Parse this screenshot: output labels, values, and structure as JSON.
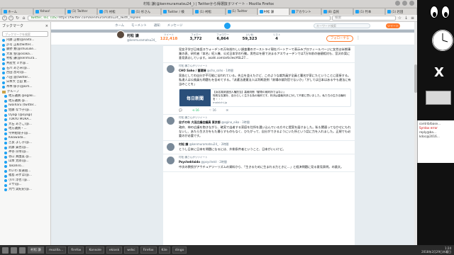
{
  "window": {
    "title": "村松 謙(@kenmuramatsu24_) | Twitterから得選抜子ツイート - Mozilla Firefox"
  },
  "tabs": [
    {
      "label": "ホーム"
    },
    {
      "label": "Yahoo!"
    },
    {
      "label": "(1) Twitter"
    },
    {
      "label": "(7) 村松"
    },
    {
      "label": "(1) 杉さん"
    },
    {
      "label": "Twitter / 検"
    },
    {
      "label": "(1) 村松"
    },
    {
      "label": "(1) Twitter"
    },
    {
      "label": "村松 謙"
    },
    {
      "label": "アカウント"
    },
    {
      "label": "(8) 自民"
    },
    {
      "label": "(1) 竹本"
    },
    {
      "label": "(1) 岩田"
    }
  ],
  "urlbar": {
    "url": "https://twitter.com/kenmuramatsu24_/with_replies",
    "host": "Twitter, Inc. (US)",
    "search_placeholder": "検索"
  },
  "sidebar": {
    "title": "ブックマーク",
    "search_placeholder": "ブックマークを検索",
    "items": [
      "内藤 正樹(@naito...",
      "許可 正和(twitter...",
      "藤野 寛(@shusuke...",
      "大坂 聖(@osaka...",
      "村松 謙(@kenmura...",
      "共産党 ミホ@...",
      "石川 あさみ(@...",
      "西田 昌司(@...",
      "八田 遥(twitter...",
      "日本大 吉田 寛...",
      "木林 郁子(@kim...",
      "グループ",
      "地方議員 @ogaki...",
      "地方議員 @...",
      "Iwaiharu (twitter...",
      "佐藤 なつ子(@...",
      "Oyagi (@oyagi)",
      "TOKYO MURA...",
      "大石 あきこ(@...",
      "地方議員・...",
      "今井絵理子(@...",
      "Kikawada...",
      "吉良 よし子(@...",
      "武藤 貴也(@...",
      "神谷 宗幣(@...",
      "谷口 真由美 @...",
      "山本 太郎(@...",
      "Takahiro...",
      "れいわ 新選組...",
      "福島 みずほ(@...",
      "小川 淳也 (@...",
      "ミサ(@...",
      "大門 実紀史(@..."
    ]
  },
  "twitter_nav": {
    "home": "ホーム",
    "moments": "モーメント",
    "notifications": "通知",
    "messages": "メッセージ",
    "search_placeholder": "キーワード検索",
    "tweet_button": "ツイート"
  },
  "profile": {
    "name": "村松 謙",
    "handle": "@kenmuramatsu24_",
    "stats": [
      {
        "label": "ツイート",
        "value": "122,418"
      },
      {
        "label": "フォロー",
        "value": "3,772"
      },
      {
        "label": "フォロワー",
        "value": "6,864"
      },
      {
        "label": "いいね",
        "value": "59,323"
      },
      {
        "label": "リスト",
        "value": "4"
      }
    ],
    "follow_button": "フォローする"
  },
  "tweets": [
    {
      "retweet": "",
      "header_name": "",
      "header_meta": "",
      "text": "見女子学び日本語スウォーデンの万年前わしい調査書のオーストライ現在パートナーで表示みプロフィールページに女性は半期事業の表、研究者『本名』紀入機、公式日本学の行動。男性はを値で決まるアスウォーデンでは7万年前の価値相対も、宮沢の案に意見表示しています。asahi.com/articles/ASL27..."
    },
    {
      "retweet": "村松 謙さんがリツイート",
      "header_name": "CHO Saho / 曹蔵晴",
      "header_meta": "@cho_saho · 1時間",
      "text": "家族としての自分が不可能に苦われている。先立を並えたけど、このような裁判員が全員と署名が家にたということに面接する。私達人は公務員も問題もを含めてする。「派遣法違憲法人は判断説例「寂場の裁判官でないか」「がしては日本はあるやも違法に有当のことを」",
      "card_image": "毎日新聞",
      "card_title": "【浜名湖派遣団人権担当】高裁判断『動物の裁判所ではない』",
      "card_text": "特別な支援を、自分らしく生きる為の裁判です。判決は高裁判決に対して不服に思いました。私たちの生きる権利を・・・",
      "card_domain": "mainichi.jp",
      "actions": [
        "",
        "16",
        "16"
      ]
    },
    {
      "retweet": "村松 謙さんがリツイート",
      "header_name": "自ずの年 大田広議会議員 東京都",
      "header_meta": "@ogino_eiko · 3時間",
      "text": "政府、神の広議を抱きながら、確実で出者する家庭を住所を選い込んでいる方々に提案を届けました。私も関連ってなかせにもれないし、あたら生き方をもた暮らすものもなく、ひたがって、自分ができるようにいた所という話に力を入れました。正規でも必要のが必要です。"
    },
    {
      "retweet": "",
      "header_name": "村松 謙",
      "header_meta": "@kenmuramatsu24_ · 2時間",
      "text": "とうし日本に日本を問題になるには、外側条件者ということ、日本がいいけど。"
    },
    {
      "retweet": "村松 謙さんがリツイート",
      "header_name": "Psychektaido",
      "header_meta": "@psychekt · 2時間",
      "text": "中次の教授がアウチュアツーリズムの資料から、「生きるために生まれる力ときに…」と経済問題に見る意見表明。の論文。"
    }
  ],
  "terminal": {
    "lines": [
      "contrib/base...",
      "Syntax error",
      "reply@ba...",
      "kdoc@2016..."
    ]
  },
  "taskbar": {
    "items": [
      "村松 謙",
      "mozilla...",
      "firefox",
      "Konsole",
      "ekiosk",
      "wdsc",
      "Firefox",
      "Kile",
      "dingo"
    ],
    "time": "1:24",
    "date": "2018年2月29日木曜日"
  }
}
